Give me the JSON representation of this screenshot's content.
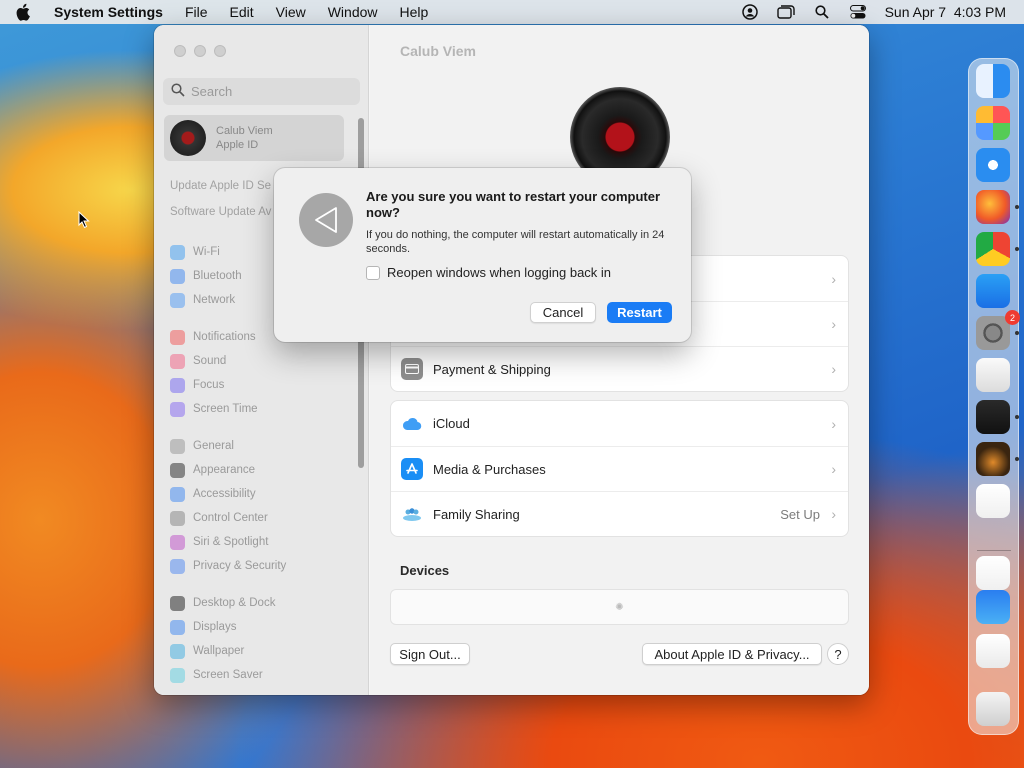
{
  "menubar": {
    "app_name": "System Settings",
    "menus": [
      "File",
      "Edit",
      "View",
      "Window",
      "Help"
    ],
    "clock": "Sun Apr 7  4:03 PM",
    "status_icons": [
      "user-icon",
      "window-icon",
      "search-icon",
      "control-center-icon"
    ]
  },
  "sidebar": {
    "search_placeholder": "Search",
    "account_name": "Calub Viem",
    "account_sub": "Apple ID",
    "links": [
      "Update Apple ID Se",
      "Software Update Av"
    ],
    "items": [
      {
        "label": "Wi-Fi",
        "color": "#4aa3f0"
      },
      {
        "label": "Bluetooth",
        "color": "#4a8ef0"
      },
      {
        "label": "Network",
        "color": "#5a9ef2"
      },
      {
        "label": "Notifications",
        "color": "#f06060"
      },
      {
        "label": "Sound",
        "color": "#f06a8a"
      },
      {
        "label": "Focus",
        "color": "#7b6ff0"
      },
      {
        "label": "Screen Time",
        "color": "#8a6ff0"
      },
      {
        "label": "General",
        "color": "#9a9a9a"
      },
      {
        "label": "Appearance",
        "color": "#333333"
      },
      {
        "label": "Accessibility",
        "color": "#4a8ef0"
      },
      {
        "label": "Control Center",
        "color": "#8a8a8a"
      },
      {
        "label": "Siri & Spotlight",
        "color": "#c05ac8"
      },
      {
        "label": "Privacy & Security",
        "color": "#5a8ef0"
      },
      {
        "label": "Desktop & Dock",
        "color": "#2a2a2a"
      },
      {
        "label": "Displays",
        "color": "#4a8ef0"
      },
      {
        "label": "Wallpaper",
        "color": "#4ab0e0"
      },
      {
        "label": "Screen Saver",
        "color": "#6ad0e0"
      }
    ]
  },
  "content": {
    "title": "Calub Viem",
    "card1": [
      {
        "label": "",
        "icon": "person-icon"
      },
      {
        "label": "",
        "icon": "lock-icon"
      },
      {
        "label": "Payment & Shipping",
        "icon": "card-icon"
      }
    ],
    "card2": [
      {
        "label": "iCloud",
        "icon": "cloud-icon",
        "value": ""
      },
      {
        "label": "Media & Purchases",
        "icon": "app-store-icon",
        "value": ""
      },
      {
        "label": "Family Sharing",
        "icon": "family-icon",
        "value": "Set Up"
      }
    ],
    "devices_header": "Devices",
    "sign_out": "Sign Out...",
    "about": "About Apple ID & Privacy...",
    "help": "?"
  },
  "dialog": {
    "title": "Are you sure you want to restart your computer now?",
    "message": "If you do nothing, the computer will restart automatically in 24 seconds.",
    "checkbox_label": "Reopen windows when logging back in",
    "checkbox_checked": false,
    "cancel": "Cancel",
    "restart": "Restart",
    "accent": "#1a7cf5"
  },
  "dock": {
    "items": [
      {
        "name": "finder-icon",
        "running": false
      },
      {
        "name": "launchpad-icon",
        "running": false
      },
      {
        "name": "safari-icon",
        "running": false
      },
      {
        "name": "firefox-icon",
        "running": true
      },
      {
        "name": "chrome-icon",
        "running": true
      },
      {
        "name": "app-store-icon",
        "running": false
      },
      {
        "name": "system-settings-icon",
        "running": true,
        "badge": "2"
      },
      {
        "name": "textedit-icon",
        "running": false
      },
      {
        "name": "terminal-icon",
        "running": true
      },
      {
        "name": "garageband-icon",
        "running": true
      },
      {
        "name": "vscode-icon",
        "running": false
      },
      {
        "name": "visual-studio-icon",
        "running": false
      },
      {
        "name": "weather-icon",
        "running": false
      },
      {
        "name": "remote-desktop-icon",
        "running": false
      },
      {
        "name": "trash-icon",
        "running": false
      }
    ]
  }
}
